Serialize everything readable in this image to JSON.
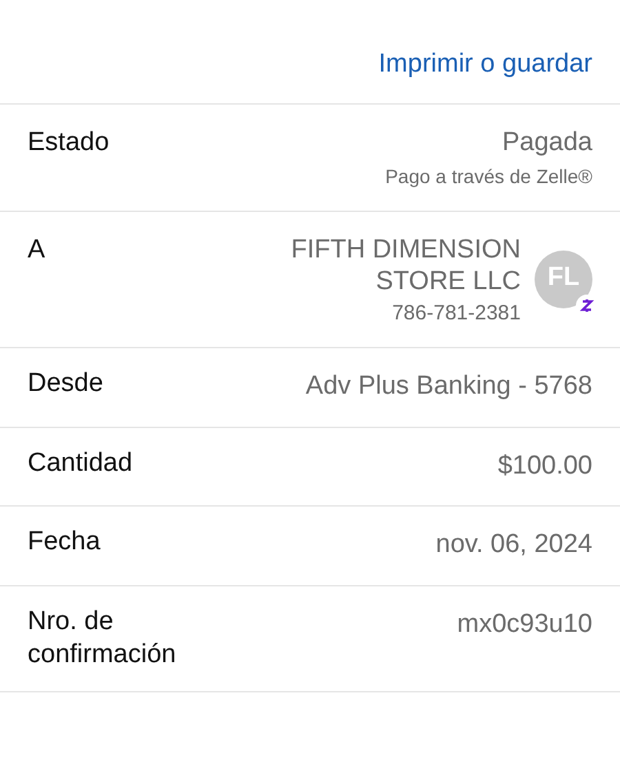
{
  "print_link": "Imprimir o guardar",
  "rows": [
    {
      "kind": "status",
      "label": "Estado",
      "value": "Pagada",
      "note": "Pago a través de Zelle®"
    },
    {
      "kind": "recipient",
      "label": "A",
      "value": "FIFTH DIMENSION STORE LLC",
      "note": "786-781-2381",
      "initials": "FL"
    },
    {
      "kind": "plain",
      "label": "Desde",
      "value": "Adv Plus Banking - 5768"
    },
    {
      "kind": "plain",
      "label": "Cantidad",
      "value": "$100.00"
    },
    {
      "kind": "plain",
      "label": "Fecha",
      "value": "nov. 06, 2024"
    },
    {
      "kind": "plain",
      "label": "Nro. de confirmación",
      "value": "mx0c93u10"
    }
  ]
}
